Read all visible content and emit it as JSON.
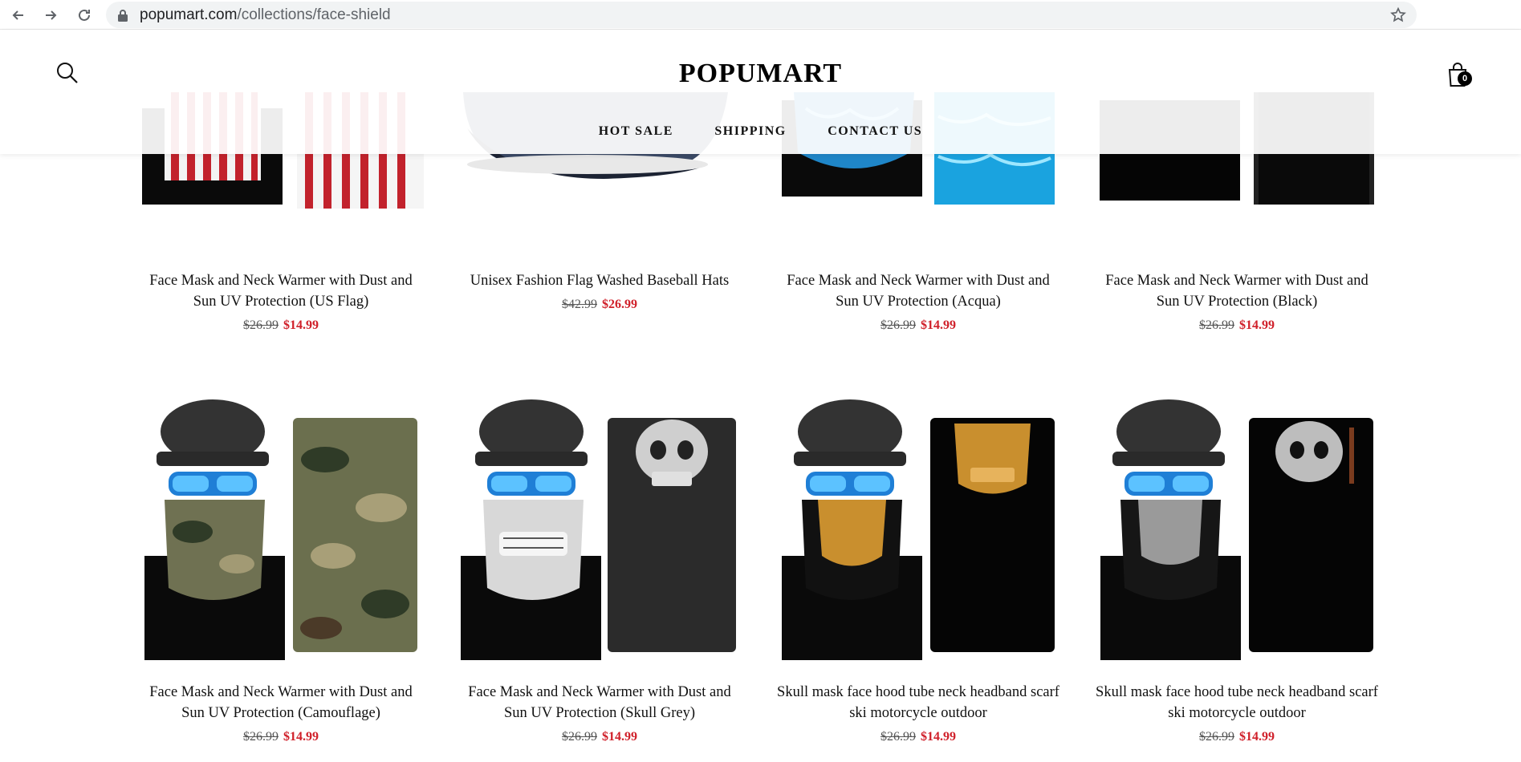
{
  "browser": {
    "url_domain": "popumart.com",
    "url_path": "/collections/face-shield"
  },
  "header": {
    "logo": "POPUMART",
    "nav": [
      "HOT SALE",
      "SHIPPING",
      "CONTACT US"
    ],
    "cart_count": "0"
  },
  "products": [
    {
      "title_line1": "Face Mask and Neck Warmer with Dust and",
      "title_line2": "Sun UV Protection (US Flag)",
      "old_price": "$26.99",
      "price": "$14.99"
    },
    {
      "title_line1": "Unisex Fashion Flag Washed Baseball Hats",
      "title_line2": "",
      "old_price": "$42.99",
      "price": "$26.99"
    },
    {
      "title_line1": "Face Mask and Neck Warmer with Dust and",
      "title_line2": "Sun UV Protection (Acqua)",
      "old_price": "$26.99",
      "price": "$14.99"
    },
    {
      "title_line1": "Face Mask and Neck Warmer with Dust and",
      "title_line2": "Sun UV Protection (Black)",
      "old_price": "$26.99",
      "price": "$14.99"
    },
    {
      "title_line1": "Face Mask and Neck Warmer with Dust and",
      "title_line2": "Sun UV Protection (Camouflage)",
      "old_price": "$26.99",
      "price": "$14.99"
    },
    {
      "title_line1": "Face Mask and Neck Warmer with Dust and",
      "title_line2": "Sun UV Protection (Skull Grey)",
      "old_price": "$26.99",
      "price": "$14.99"
    },
    {
      "title_line1": "Skull mask face hood tube neck headband scarf",
      "title_line2": "ski motorcycle outdoor",
      "old_price": "$26.99",
      "price": "$14.99"
    },
    {
      "title_line1": "Skull mask face hood tube neck headband scarf",
      "title_line2": "ski motorcycle outdoor",
      "old_price": "$26.99",
      "price": "$14.99"
    }
  ],
  "colors": {
    "sale_price": "#d0202a",
    "old_price": "#555555"
  }
}
